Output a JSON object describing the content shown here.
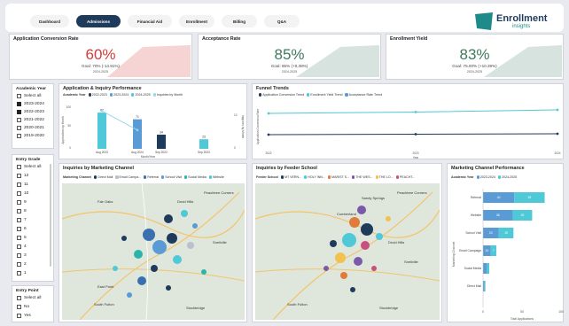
{
  "nav": {
    "tabs": [
      "Dashboard",
      "Admissions",
      "Financial Aid",
      "Enrollment",
      "Billing",
      "Q&A"
    ],
    "active": "Admissions"
  },
  "logo": {
    "line1": "Enrollment",
    "line2": "insights"
  },
  "kpis": [
    {
      "title": "Application Conversion Rate",
      "value": "60%",
      "goal": "Goal: 70% (-14.91%)",
      "year": "2024-2025",
      "color": "#d73a3a",
      "fill": "#f6d4d4"
    },
    {
      "title": "Acceptance Rate",
      "value": "85%",
      "goal": "Goal: 85% (+0.38%)",
      "year": "2024-2025",
      "color": "#3f7a5c",
      "fill": "#d7e3de"
    },
    {
      "title": "Enrollment Yield",
      "value": "83%",
      "goal": "Goal: 75.00% (+10.39%)",
      "year": "2024-2025",
      "color": "#3f7a5c",
      "fill": "#d7e3de"
    }
  ],
  "slicers": {
    "academic_year": {
      "title": "Academic Year",
      "items": [
        {
          "label": "Select all",
          "checked": false
        },
        {
          "label": "2023-2024",
          "checked": true
        },
        {
          "label": "2022-2023",
          "checked": true
        },
        {
          "label": "2021-2022",
          "checked": false
        },
        {
          "label": "2020-2021",
          "checked": false
        },
        {
          "label": "2019-2020",
          "checked": false
        }
      ]
    },
    "entry_grade": {
      "title": "Entry Grade",
      "items": [
        "Select all",
        "12",
        "11",
        "10",
        "9",
        "8",
        "7",
        "6",
        "5",
        "4",
        "3",
        "2",
        "1"
      ]
    },
    "entry_point": {
      "title": "Entry Point",
      "items": [
        "Select all",
        "No",
        "Yes"
      ]
    }
  },
  "app_inquiry": {
    "title": "Application & Inquiry Performance",
    "legend_label": "Academic Year",
    "legend": [
      {
        "label": "2022-2023",
        "color": "#1f3b5c"
      },
      {
        "label": "2023-2024",
        "color": "#5b9bd5"
      },
      {
        "label": "2024-2025",
        "color": "#4fc8d8"
      },
      {
        "label": "Inquiries by Month",
        "color": "#9ad7ee"
      }
    ],
    "y_label": "Applications by Month",
    "y2_label": "Inquiries by Month",
    "x_label": "Month/Year"
  },
  "funnel": {
    "title": "Funnel Trends",
    "legend": [
      {
        "label": "Application Conversion Trend",
        "color": "#1f3b5c"
      },
      {
        "label": "Enrollment Yield Trend",
        "color": "#4fc8d8"
      },
      {
        "label": "Acceptance Rate Trend",
        "color": "#5b9bd5"
      }
    ],
    "y_label": "Application Conversion Rate",
    "x_label": "Year"
  },
  "inq_channel": {
    "title": "Inquiries by Marketing Channel",
    "legend_label": "Marketing Channel",
    "legend": [
      {
        "label": "Direct Mail",
        "color": "#1f3b5c"
      },
      {
        "label": "Email Campa...",
        "color": "#b9c2cc"
      },
      {
        "label": "Referral",
        "color": "#3a6fb0"
      },
      {
        "label": "School Visit",
        "color": "#5b9bd5"
      },
      {
        "label": "Social Media",
        "color": "#2bb5a9"
      },
      {
        "label": "Website",
        "color": "#4fc8d8"
      }
    ],
    "map_labels": [
      "Fair Oaks",
      "Druid Hills",
      "Peachtree Corners",
      "Snellville",
      "East Point",
      "South Fulton",
      "Stockbridge"
    ]
  },
  "inq_feeder": {
    "title": "Inquiries by Feeder School",
    "legend_label": "Feeder School",
    "legend": [
      {
        "label": "MT VERN...",
        "color": "#1f3b5c"
      },
      {
        "label": "HOLY INN...",
        "color": "#4fc8d8"
      },
      {
        "label": "MARIST S...",
        "color": "#e07b39"
      },
      {
        "label": "THE WES...",
        "color": "#7a59a8"
      },
      {
        "label": "THE LO...",
        "color": "#f2c14e"
      },
      {
        "label": "PEACHT...",
        "color": "#c94f7c"
      }
    ],
    "map_labels": [
      "Cumberland",
      "Sandy Springs",
      "Peachtree Corners",
      "Druid Hills",
      "Snellville",
      "South Fulton",
      "Stockbridge"
    ]
  },
  "mkt_perf": {
    "title": "Marketing Channel Performance",
    "legend_label": "Academic Year",
    "legend": [
      {
        "label": "2022-2023",
        "color": "#1f3b5c"
      },
      {
        "label": "2023-2024",
        "color": "#5b9bd5"
      },
      {
        "label": "2024-2025",
        "color": "#4fc8d8"
      }
    ],
    "y_label": "Marketing Channel",
    "x_label": "Total Applications"
  },
  "chart_data": [
    {
      "type": "bar",
      "title": "Application & Inquiry Performance",
      "xlabel": "Month/Year",
      "ylabel": "Applications by Month",
      "y2label": "Inquiries by Month",
      "categories": [
        "Aug 2023",
        "Aug 2024",
        "Sep 2022",
        "Sep 2023"
      ],
      "series": [
        {
          "name": "2022-2023",
          "values": [
            null,
            null,
            34,
            null
          ]
        },
        {
          "name": "2023-2024",
          "values": [
            null,
            71,
            null,
            null
          ]
        },
        {
          "name": "2024-2025",
          "values": [
            87,
            null,
            null,
            23
          ]
        },
        {
          "name": "Inquiries by Month",
          "values": [
            91,
            45,
            null,
            null
          ]
        }
      ],
      "bar_values": [
        87,
        71,
        34,
        23
      ],
      "bar_colors": [
        "#4fc8d8",
        "#5b9bd5",
        "#1f3b5c",
        "#4fc8d8"
      ],
      "bar_labels": [
        "87",
        "71",
        "34",
        "23"
      ],
      "line_points": [
        91,
        45
      ],
      "ylim": [
        0,
        100
      ],
      "y_ticks": [
        "100",
        "50",
        "0"
      ],
      "y2_ticks": [
        "10",
        "0"
      ]
    },
    {
      "type": "line",
      "title": "Funnel Trends",
      "xlabel": "Year",
      "x": [
        "2022",
        "2023",
        "2024"
      ],
      "series": [
        {
          "name": "Application Conversion Trend",
          "values": [
            0.3,
            0.31,
            0.32
          ]
        },
        {
          "name": "Enrollment Yield Trend",
          "values": [
            0.78,
            0.81,
            0.86
          ]
        },
        {
          "name": "Acceptance Rate Trend",
          "values": [
            0.78,
            0.81,
            0.86
          ]
        }
      ],
      "ylim": [
        0,
        1
      ]
    },
    {
      "type": "bar",
      "orientation": "horizontal",
      "stacked": true,
      "title": "Marketing Channel Performance",
      "xlabel": "Total Applications",
      "ylabel": "Marketing Channel",
      "categories": [
        "Referral",
        "Website",
        "School Visit",
        "Email Campaign",
        "Social Media",
        "Direct Mail"
      ],
      "series": [
        {
          "name": "2023-2024",
          "values": [
            40,
            38,
            20,
            10,
            5,
            2
          ]
        },
        {
          "name": "2024-2025",
          "values": [
            39,
            25,
            19,
            7,
            3,
            1
          ]
        }
      ],
      "segment_labels": [
        [
          "40",
          "39"
        ],
        [
          "38",
          "25"
        ],
        [
          "20",
          "19"
        ],
        [
          "10",
          "7"
        ],
        [
          "",
          ""
        ],
        [
          "",
          ""
        ]
      ],
      "xlim": [
        0,
        100
      ],
      "x_ticks": [
        "0",
        "50",
        "100"
      ]
    }
  ]
}
